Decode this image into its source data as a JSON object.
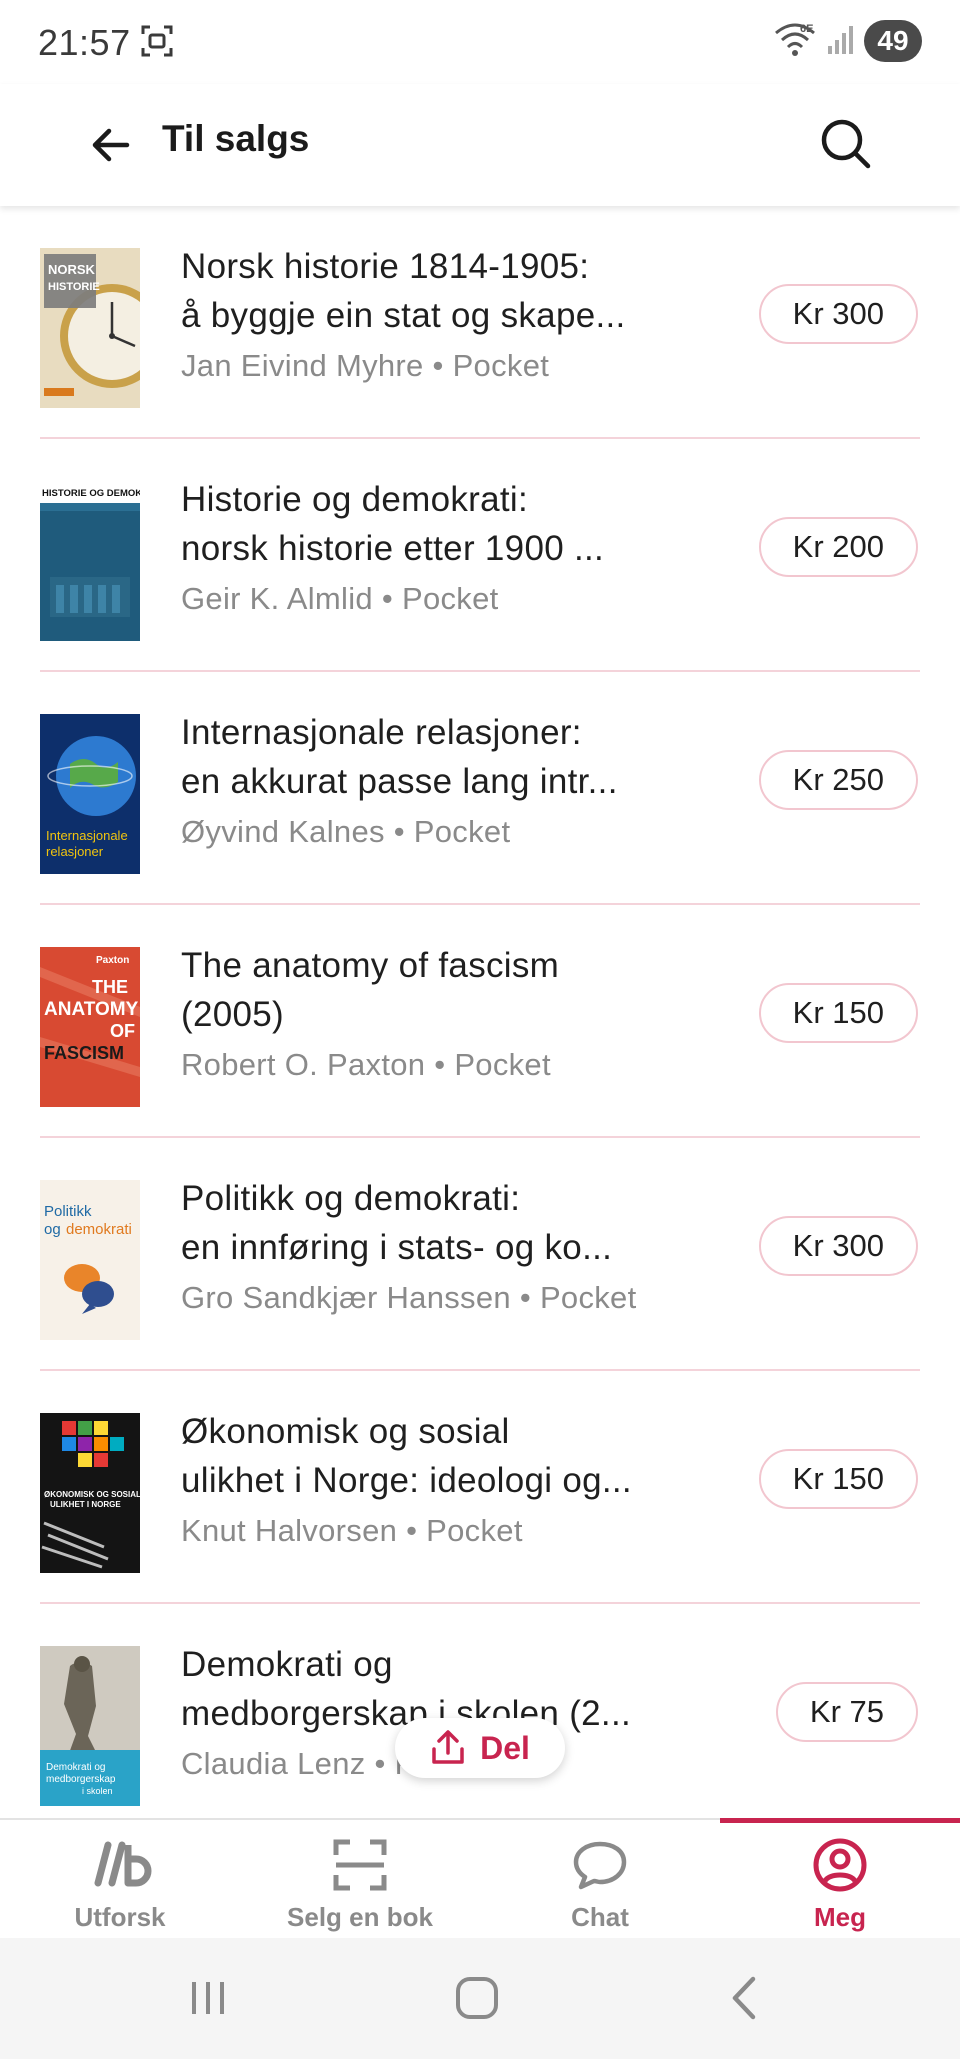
{
  "status_bar": {
    "time": "21:57",
    "battery": "49",
    "network": "6E"
  },
  "app_bar": {
    "title": "Til salgs"
  },
  "books": [
    {
      "title_line1": "Norsk historie 1814-1905:",
      "title_line2": "å byggje ein stat og skape...",
      "author": "Jan Eivind Myhre",
      "format": "Pocket",
      "price": "Kr 300",
      "cover_text": "NORSK HISTORIE"
    },
    {
      "title_line1": "Historie og demokrati:",
      "title_line2": "norsk historie etter 1900 ...",
      "author": "Geir K. Almlid",
      "format": "Pocket",
      "price": "Kr 200",
      "cover_text": "HISTORIE OG DEMOKRATI"
    },
    {
      "title_line1": "Internasjonale relasjoner:",
      "title_line2": "en akkurat passe lang intr...",
      "author": "Øyvind Kalnes",
      "format": "Pocket",
      "price": "Kr 250",
      "cover_text": "Internasjonale relasjoner"
    },
    {
      "title_line1": "The anatomy of fascism",
      "title_line2": "(2005)",
      "author": "Robert O. Paxton ",
      "format": "Pocket",
      "price": "Kr 150",
      "cover_text": "THE ANATOMY OF FASCISM"
    },
    {
      "title_line1": "Politikk og demokrati:",
      "title_line2": "en innføring i stats- og ko...",
      "author": "Gro Sandkjær Hanssen",
      "format": "Pocket",
      "price": "Kr 300",
      "cover_text": "Politikk og demokrati"
    },
    {
      "title_line1": "Økonomisk og sosial",
      "title_line2": "ulikhet i Norge: ideologi og...",
      "author": "Knut Halvorsen",
      "format": "Pocket",
      "price": "Kr 150",
      "cover_text": "ØKONOMISK OG SOSIAL ULIKHET I NORGE"
    },
    {
      "title_line1": "Demokrati og",
      "title_line2": "medborgerskap i skolen (2...",
      "author": "Claudia Lenz",
      "format": "Pocket",
      "price": "Kr 75",
      "cover_text": "Demokrati og medborgerskap i skolen"
    }
  ],
  "separator": "•",
  "share": {
    "label": "Del"
  },
  "bottom_nav": [
    {
      "label": "Utforsk",
      "icon": "lb-logo-icon"
    },
    {
      "label": "Selg en bok",
      "icon": "scan-icon"
    },
    {
      "label": "Chat",
      "icon": "chat-bubble-icon"
    },
    {
      "label": "Meg",
      "icon": "profile-icon",
      "active": true
    }
  ],
  "colors": {
    "accent": "#c8244f",
    "divider": "#f4d3da",
    "chip_border": "#f2c6cf"
  }
}
